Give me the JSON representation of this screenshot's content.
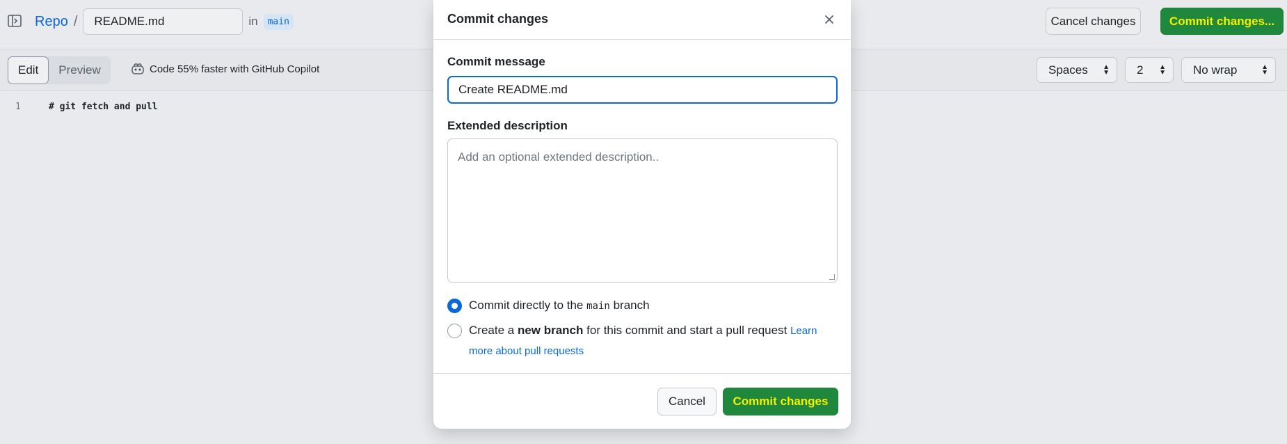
{
  "header": {
    "repo": "Repo",
    "separator": "/",
    "filename": "README.md",
    "in_text": "in",
    "branch": "main",
    "cancel_label": "Cancel changes",
    "commit_label": "Commit changes..."
  },
  "editor": {
    "tabs": [
      "Edit",
      "Preview"
    ],
    "copilot_text": "Code 55% faster with GitHub Copilot",
    "indent_mode": "Spaces",
    "indent_size": "2",
    "wrap_mode": "No wrap",
    "lines": [
      {
        "number": "1",
        "text": "# git fetch and pull"
      }
    ]
  },
  "modal": {
    "title": "Commit changes",
    "message_label": "Commit message",
    "message_value": "Create README.md",
    "description_label": "Extended description",
    "description_placeholder": "Add an optional extended description..",
    "option_direct_prefix": "Commit directly to the",
    "option_direct_branch": "main",
    "option_direct_suffix": "branch",
    "option_new_prefix": "Create a",
    "option_new_bold": "new branch",
    "option_new_suffix": "for this commit and start a pull request",
    "learn_more_1": "Learn",
    "learn_more_2": "more about pull requests",
    "cancel_label": "Cancel",
    "commit_label": "Commit changes"
  },
  "colors": {
    "accent": "#0969da",
    "commit_green": "#1f883d",
    "highlight_yellow": "#f5f200"
  }
}
